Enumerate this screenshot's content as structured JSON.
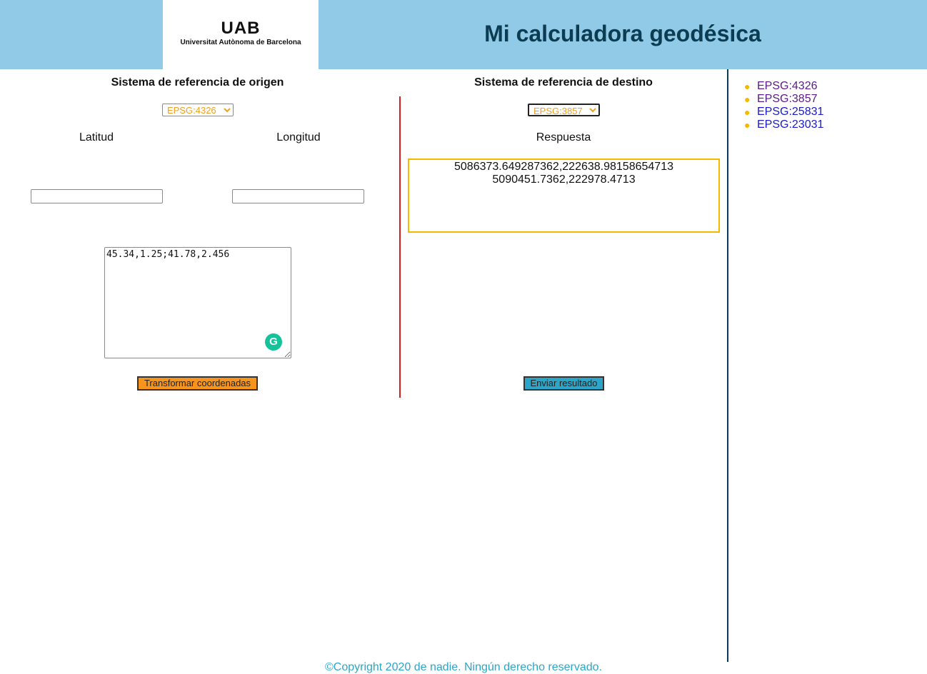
{
  "header": {
    "logo_mark": "UAB",
    "logo_subtitle": "Universitat Autònoma de Barcelona",
    "title": "Mi calculadora geodésica",
    "background_color": "#90cae6",
    "title_color": "#0b3c52"
  },
  "origin": {
    "heading": "Sistema de referencia de origen",
    "select_value": "EPSG:4326",
    "latitude_label": "Latitud",
    "longitude_label": "Longitud",
    "latitude_value": "",
    "longitude_value": "",
    "coordinates_text": "45.34,1.25;41.78,2.456",
    "transform_button": "Transformar coordenadas",
    "transform_button_color": "#f7941d"
  },
  "destination": {
    "heading": "Sistema de referencia de destino",
    "select_value": "EPSG:3857",
    "answer_label": "Respuesta",
    "results": [
      "5086373.649287362,222638.98158654713",
      "5090451.7362,222978.4713"
    ],
    "send_button": "Enviar resultado",
    "send_button_color": "#2ba6c9",
    "result_border_color": "#f5b800"
  },
  "sidebar": {
    "links": [
      {
        "label": "EPSG:4326",
        "visited": true
      },
      {
        "label": "EPSG:3857",
        "visited": true
      },
      {
        "label": "EPSG:25831",
        "visited": false
      },
      {
        "label": "EPSG:23031",
        "visited": false
      }
    ],
    "bullet_color": "#f5b800"
  },
  "footer": {
    "text": "©Copyright 2020 de nadie. Ningún derecho reservado.",
    "color": "#2ba6c9"
  },
  "icons": {
    "grammarly": "grammarly-icon"
  }
}
